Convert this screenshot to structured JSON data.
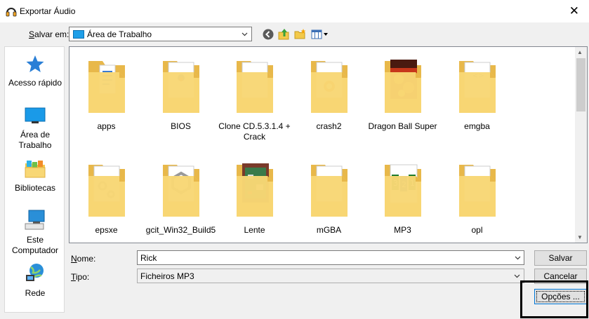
{
  "window": {
    "title": "Exportar Áudio",
    "close_glyph": "✕"
  },
  "savein": {
    "label_underlined": "S",
    "label_rest": "alvar em:",
    "value": "Área de Trabalho"
  },
  "toolbar": [
    "back-icon",
    "up-folder-icon",
    "new-folder-icon",
    "view-menu-icon"
  ],
  "places": [
    {
      "id": "quick-access",
      "icon": "star-icon",
      "label": "Acesso rápido"
    },
    {
      "id": "desktop",
      "icon": "desktop-icon",
      "label": "Área de Trabalho"
    },
    {
      "id": "libraries",
      "icon": "libraries-icon",
      "label": "Bibliotecas"
    },
    {
      "id": "this-pc",
      "icon": "computer-icon",
      "label": "Este Computador"
    },
    {
      "id": "network",
      "icon": "network-icon",
      "label": "Rede"
    }
  ],
  "files": [
    {
      "name": "apps",
      "preview": "docs"
    },
    {
      "name": "BIOS",
      "preview": "bios"
    },
    {
      "name": "Clone CD.5.3.1.4 + Crack",
      "preview": "plain"
    },
    {
      "name": "crash2",
      "preview": "crash"
    },
    {
      "name": "Dragon Ball Super",
      "preview": "fire"
    },
    {
      "name": "emgba",
      "preview": "code"
    },
    {
      "name": "epsxe",
      "preview": "gears"
    },
    {
      "name": "gcit_Win32_Build5",
      "preview": "gc"
    },
    {
      "name": "Lente",
      "preview": "circuit"
    },
    {
      "name": "mGBA",
      "preview": "plain"
    },
    {
      "name": "MP3",
      "preview": "numbers"
    },
    {
      "name": "opl",
      "preview": "plain"
    }
  ],
  "form": {
    "name_label_underlined": "N",
    "name_label_rest": "ome:",
    "name_value": "Rick",
    "type_label_underlined": "T",
    "type_label_rest": "ipo:",
    "type_value": "Ficheiros MP3"
  },
  "buttons": {
    "save": "Salvar",
    "cancel": "Cancelar",
    "options": "Opções ..."
  },
  "colors": {
    "folder": "#f8d775",
    "folder_dark": "#e8b84a",
    "accent": "#0078d7"
  }
}
